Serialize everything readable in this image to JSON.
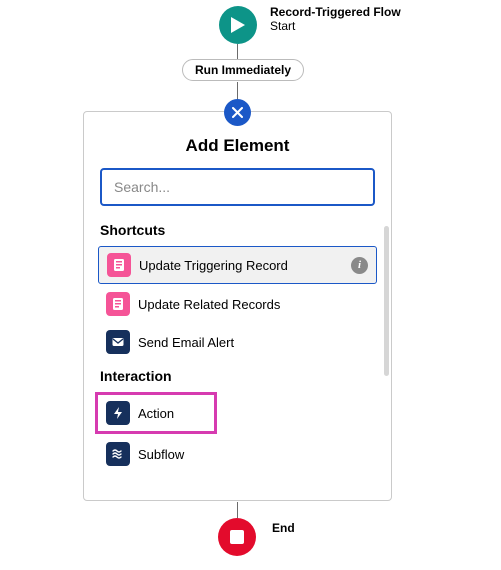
{
  "start": {
    "title": "Record-Triggered Flow",
    "subtitle": "Start"
  },
  "run_pill": "Run Immediately",
  "panel": {
    "title": "Add Element",
    "search_placeholder": "Search...",
    "sections": {
      "shortcuts": {
        "heading": "Shortcuts",
        "items": [
          {
            "label": "Update Triggering Record"
          },
          {
            "label": "Update Related Records"
          },
          {
            "label": "Send Email Alert"
          }
        ]
      },
      "interaction": {
        "heading": "Interaction",
        "items": [
          {
            "label": "Action"
          },
          {
            "label": "Subflow"
          }
        ]
      }
    }
  },
  "end": {
    "label": "End"
  },
  "info_glyph": "i"
}
